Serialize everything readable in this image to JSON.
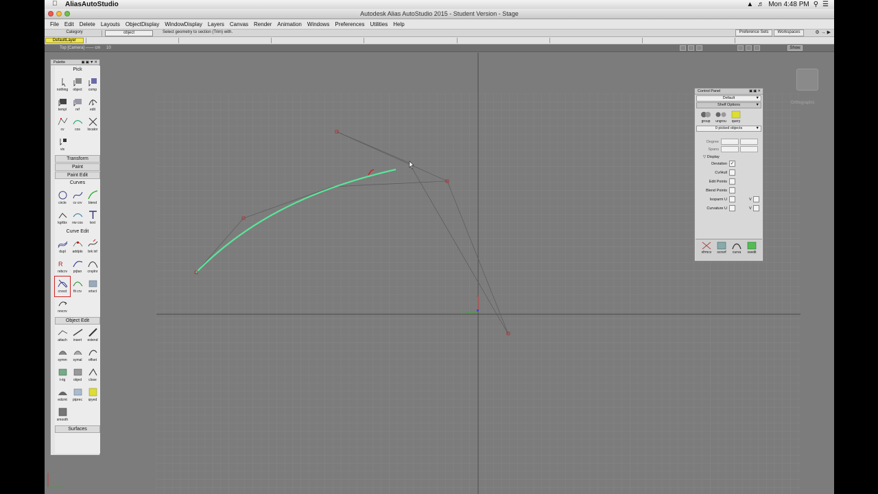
{
  "mac_menubar": {
    "app_name": "AliasAutoStudio",
    "clock": "Mon 4:48 PM"
  },
  "window": {
    "title": "Autodesk Alias AutoStudio 2015  - Student Version  - Stage"
  },
  "menu": {
    "items": [
      "File",
      "Edit",
      "Delete",
      "Layouts",
      "ObjectDisplay",
      "WindowDisplay",
      "Layers",
      "Canvas",
      "Render",
      "Animation",
      "Windows",
      "Preferences",
      "Utilities",
      "Help"
    ]
  },
  "option_bar": {
    "category_label": "Category",
    "mode_label": "object",
    "prompt": "Select geometry to section (Trim) with.",
    "preference_sets": "Preference Sets",
    "workspaces": "Workspaces"
  },
  "layer_bar": {
    "default_layer": "DefaultLayer"
  },
  "viewport_header": {
    "title": "Top [Camera] —— cm",
    "scale": "10",
    "show_button": "Show"
  },
  "palette": {
    "title": "Palette",
    "pick": {
      "header": "Pick",
      "tools": [
        "nothing",
        "object",
        "comp",
        "templ",
        "ref",
        "edit",
        "cv",
        "cos",
        "locator",
        "vis"
      ]
    },
    "transform_header": "Transform",
    "paint_header": "Paint",
    "paint_edit_header": "Paint Edit",
    "curves": {
      "header": "Curves",
      "tools": [
        "circle",
        "cv crv",
        "blend",
        "kgrtbx",
        "nw cos",
        "text"
      ]
    },
    "curve_edit": {
      "header": "Curve Edit",
      "tools": [
        "dupl",
        "addpts",
        "brk inf",
        "rebcrv",
        "prjtan",
        "crvplnr",
        "crvsct",
        "fit crv",
        "srtsct",
        "revcrv"
      ]
    },
    "object_edit": {
      "header": "Object Edit",
      "tools": [
        "attach",
        "insert",
        "extend",
        "symm",
        "symal",
        "offset",
        "t-rig",
        "objed",
        "close",
        "edcmt",
        "ptprec",
        "qryed",
        "smooth"
      ]
    },
    "surfaces_header": "Surfaces"
  },
  "control_panel": {
    "title": "Control Panel",
    "preset": "Default",
    "shelf_options": "Shelf Options",
    "shelf_tools": [
      "group",
      "ungrou",
      "query"
    ],
    "picked_objects": "0 picked objects",
    "degree_label": "Degree",
    "spans_label": "Spans",
    "display_title": "Display",
    "display_rows": [
      {
        "label": "Deviation",
        "checked": true
      },
      {
        "label": "Cv/Hull",
        "checked": false
      },
      {
        "label": "Edit Points",
        "checked": false
      },
      {
        "label": "Blend Points",
        "checked": false
      },
      {
        "label": "Isoparm U",
        "checked": false,
        "v": true
      },
      {
        "label": "Curvature U",
        "checked": false,
        "v": true
      }
    ],
    "v_label": "V",
    "bottom_tools": [
      "xfrmcv",
      "scnsrf",
      "curva",
      "xsedit"
    ]
  },
  "viewport_badge": {
    "label": "Orthographic"
  },
  "colors": {
    "curve_highlight": "#59e69a",
    "hull_line": "#5a5a5a",
    "cv_point": "#b03030",
    "axis_x": "#cc3333",
    "axis_y": "#33aa33",
    "grid_line": "#858585",
    "layer_yellow": "#f0e55a"
  }
}
